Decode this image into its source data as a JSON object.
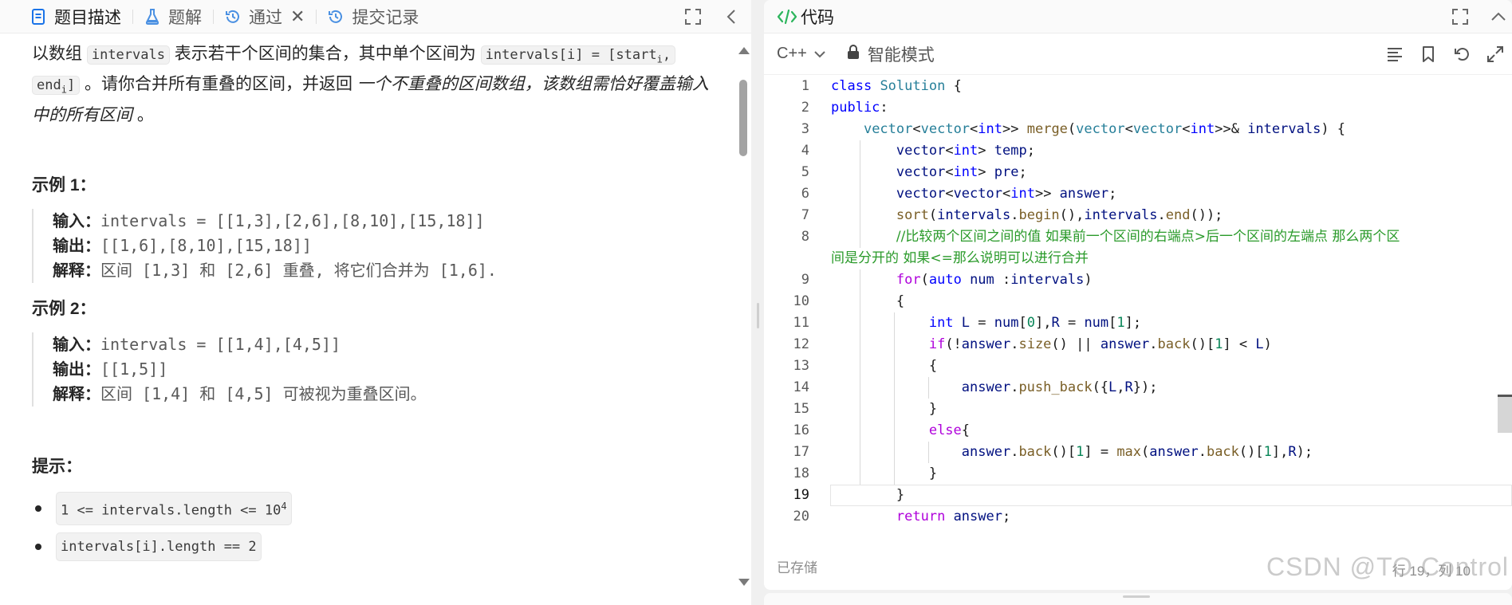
{
  "left_tabs": {
    "description": "题目描述",
    "solution": "题解",
    "passed": "通过",
    "submissions": "提交记录"
  },
  "problem": {
    "p1_a": "以数组 ",
    "p1_code1": "intervals",
    "p1_b": " 表示若干个区间的集合，其中单个区间为 ",
    "p1_code2a": "intervals[i] = [start",
    "p1_code2_sub1": "i",
    "p1_code2b": ",",
    "p1_code3a": "end",
    "p1_code3_sub": "i",
    "p1_code3b": "]",
    "p1_c": " 。请你合并所有重叠的区间，并返回 ",
    "p1_d": "一个不重叠的区间数组，该数组需恰好覆盖输入中的所有区间",
    "p1_e": " 。",
    "example1_title": "示例 1：",
    "example1_input_label": "输入：",
    "example1_input": "intervals = [[1,3],[2,6],[8,10],[15,18]]",
    "example1_output_label": "输出：",
    "example1_output": "[[1,6],[8,10],[15,18]]",
    "example1_expl_label": "解释：",
    "example1_expl": "区间 [1,3] 和 [2,6] 重叠, 将它们合并为 [1,6].",
    "example2_title": "示例 2：",
    "example2_input_label": "输入：",
    "example2_input": "intervals = [[1,4],[4,5]]",
    "example2_output_label": "输出：",
    "example2_output": "[[1,5]]",
    "example2_expl_label": "解释：",
    "example2_expl": "区间 [1,4] 和 [4,5] 可被视为重叠区间。",
    "hint_title": "提示：",
    "hint1_a": "1 <= intervals.length <= 10",
    "hint1_sup": "4",
    "hint2": "intervals[i].length == 2"
  },
  "editor": {
    "title": "代码",
    "language": "C++",
    "mode": "智能模式",
    "saved_status": "已存储",
    "cursor_position": "行 19，列 10",
    "watermark": "CSDN @TO Control",
    "line_numbers": [
      "1",
      "2",
      "3",
      "4",
      "5",
      "6",
      "7",
      "8",
      "",
      "9",
      "10",
      "11",
      "12",
      "13",
      "14",
      "15",
      "16",
      "17",
      "18",
      "19",
      "20"
    ]
  },
  "colors": {
    "accent_blue": "#1a73e8",
    "code_keyword": "#0000ff",
    "code_type": "#267f99",
    "code_function": "#795e26",
    "code_variable": "#001080",
    "code_number": "#098658",
    "code_comment": "#2a9a2a",
    "code_control": "#af00db"
  },
  "icons": {
    "description_tab": "document-icon",
    "solution_tab": "flask-icon",
    "passed_tab": "history-icon",
    "submissions_tab": "history-icon",
    "fullscreen": "expand-icon",
    "collapse": "chevron-left-icon",
    "code_title": "code-brackets-icon",
    "lock": "lock-icon",
    "format": "align-left-icon",
    "bookmark": "bookmark-icon",
    "reset": "undo-icon",
    "maximize": "maximize-icon"
  }
}
